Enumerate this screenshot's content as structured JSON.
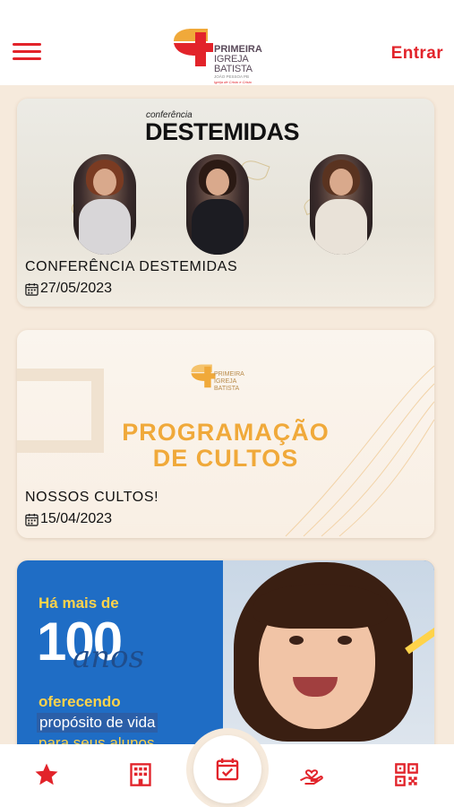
{
  "header": {
    "logo": {
      "line1": "PRIMEIRA",
      "line2": "IGREJA BATISTA",
      "line3": "JOÃO PESSOA PB",
      "line4": "Igreja de Cristo e Cristo"
    },
    "login_label": "Entrar"
  },
  "events": [
    {
      "banner_sub": "conferência",
      "banner_title": "DESTEMIDAS",
      "title": "CONFERÊNCIA DESTEMIDAS",
      "date": "27/05/2023"
    },
    {
      "banner_logo": {
        "line1": "PRIMEIRA",
        "line2": "IGREJA BATISTA"
      },
      "banner_title_l1": "PROGRAMAÇÃO",
      "banner_title_l2": "DE CULTOS",
      "title": "NOSSOS CULTOS!",
      "date": "15/04/2023"
    },
    {
      "banner_l0": "Há mais de",
      "banner_big": "100",
      "banner_script": "anos",
      "banner_l1": "oferecendo",
      "banner_l2": "propósito de vida",
      "banner_l3": "para seus alunos"
    }
  ],
  "bottom_nav": [
    {
      "icon": "star-icon"
    },
    {
      "icon": "building-icon"
    },
    {
      "icon": "calendar-check-icon"
    },
    {
      "icon": "hand-heart-icon"
    },
    {
      "icon": "qr-code-icon"
    }
  ],
  "colors": {
    "accent": "#e2232a",
    "background": "#f6eadc",
    "gold": "#f0a93a"
  }
}
